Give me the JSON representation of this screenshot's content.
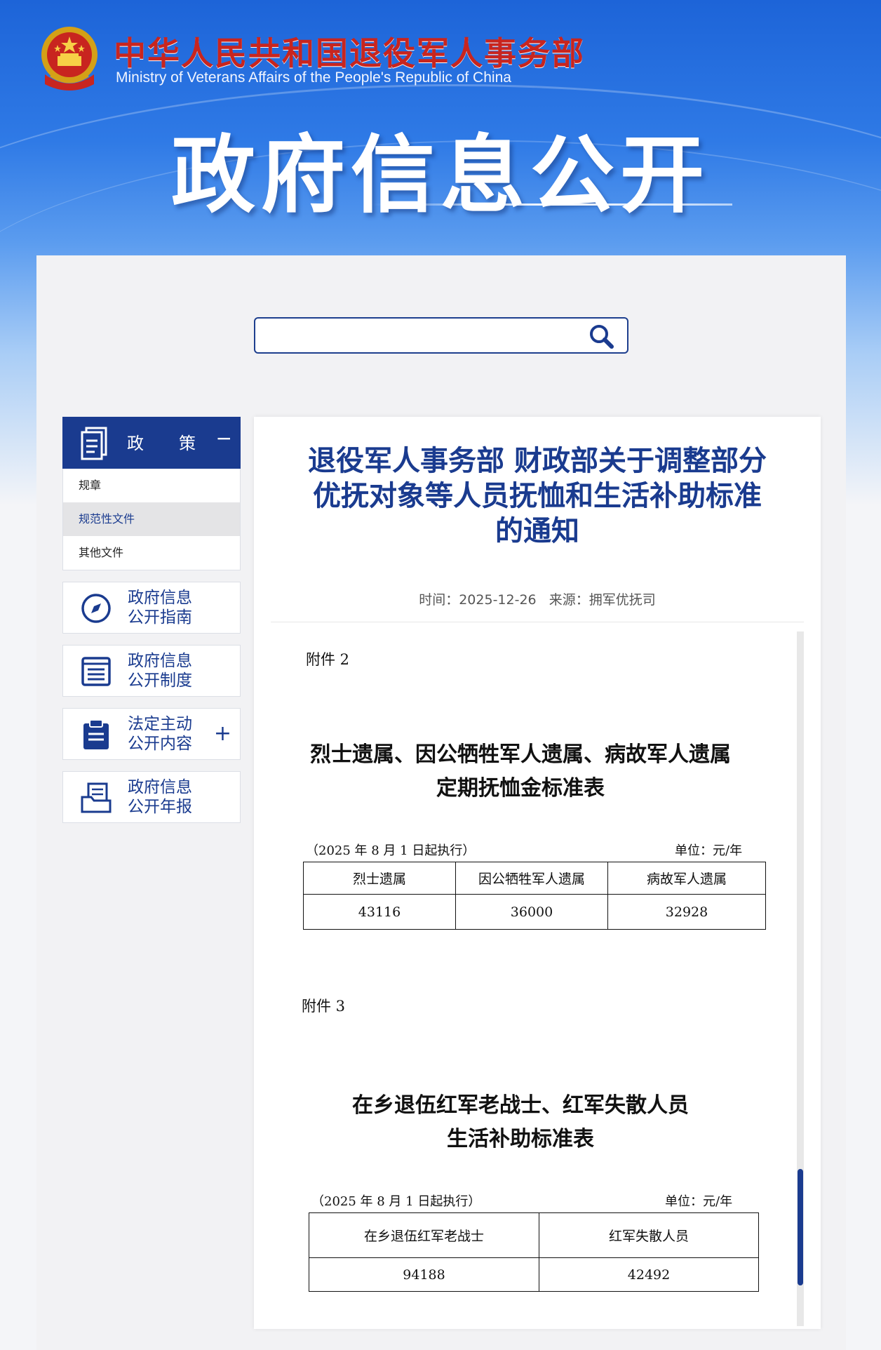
{
  "header": {
    "org_name_cn": "中华人民共和国退役军人事务部",
    "org_name_en": "Ministry of Veterans Affairs of the People's Republic of China",
    "page_title": "政府信息公开"
  },
  "search": {
    "placeholder": ""
  },
  "sidebar": {
    "category": {
      "label_a": "政",
      "label_b": "策",
      "toggle": "−"
    },
    "sub_items": [
      {
        "label": "规章"
      },
      {
        "label": "规范性文件"
      },
      {
        "label": "其他文件"
      }
    ],
    "nav": [
      {
        "line1": "政府信息",
        "line2": "公开指南",
        "icon": "compass-icon"
      },
      {
        "line1": "政府信息",
        "line2": "公开制度",
        "icon": "list-icon"
      },
      {
        "line1": "法定主动",
        "line2": "公开内容",
        "icon": "clipboard-icon",
        "toggle": "+"
      },
      {
        "line1": "政府信息",
        "line2": "公开年报",
        "icon": "folder-doc-icon"
      }
    ]
  },
  "article": {
    "title_l1": "退役军人事务部 财政部关于调整部分",
    "title_l2": "优抚对象等人员抚恤和生活补助标准",
    "title_l3": "的通知",
    "meta": "时间：2025-12-26   来源：拥军优抚司"
  },
  "attachment2": {
    "label": "附件 2",
    "title_l1": "烈士遗属、因公牺牲军人遗属、病故军人遗属",
    "title_l2": "定期抚恤金标准表",
    "effective": "（2025 年 8 月 1 日起执行）",
    "unit": "单位：元/年",
    "headers": [
      "烈士遗属",
      "因公牺牲军人遗属",
      "病故军人遗属"
    ],
    "values": [
      "43116",
      "36000",
      "32928"
    ]
  },
  "attachment3": {
    "label": "附件 3",
    "title_l1": "在乡退伍红军老战士、红军失散人员",
    "title_l2": "生活补助标准表",
    "effective": "（2025 年 8 月 1 日起执行）",
    "unit": "单位：元/年",
    "headers": [
      "在乡退伍红军老战士",
      "红军失散人员"
    ],
    "values": [
      "94188",
      "42492"
    ]
  }
}
